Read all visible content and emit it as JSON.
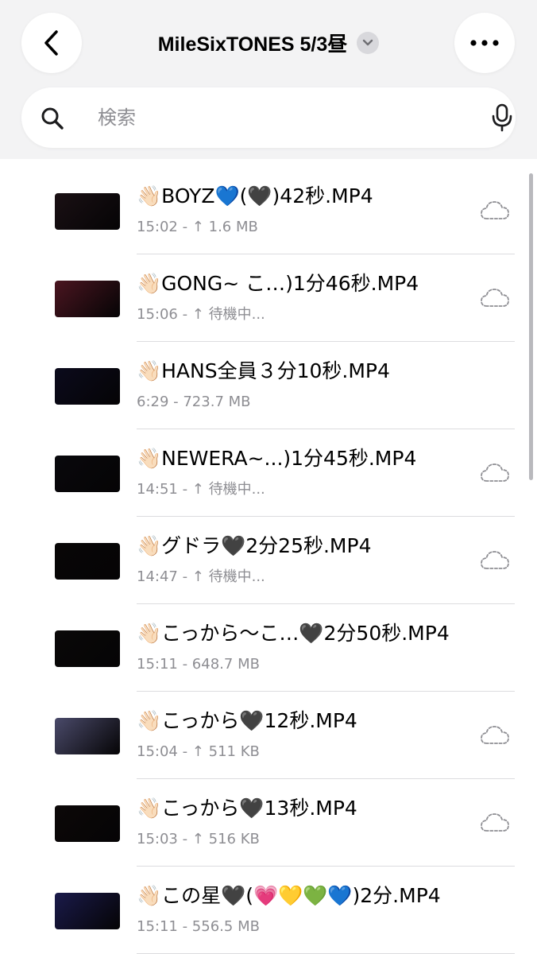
{
  "header": {
    "title": "MileSixTONES 5/3昼",
    "back_icon": "chevron-left-icon",
    "title_menu_icon": "chevron-down-icon",
    "more_icon": "ellipsis-icon"
  },
  "search": {
    "placeholder": "検索",
    "icon": "search-icon",
    "mic_icon": "microphone-icon"
  },
  "files": [
    {
      "name": "👋🏻BOYZ💙(🖤)42秒.MP4",
      "meta": "15:02 - ↑ 1.6 MB",
      "cloud": true,
      "thumb": "#1a1014"
    },
    {
      "name": "👋🏻GONG~ こ…)1分46秒.MP4",
      "meta": "15:06 - ↑ 待機中...",
      "cloud": true,
      "thumb": "#4a1520"
    },
    {
      "name": "👋🏻HANS全員３分10秒.MP4",
      "meta": "6:29 - 723.7 MB",
      "cloud": false,
      "thumb": "#0b0a1c"
    },
    {
      "name": "👋🏻NEWERA~...)1分45秒.MP4",
      "meta": "14:51 - ↑ 待機中...",
      "cloud": true,
      "thumb": "#09080c"
    },
    {
      "name": "👋🏻グドラ🖤2分25秒.MP4",
      "meta": "14:47 - ↑ 待機中...",
      "cloud": true,
      "thumb": "#080606"
    },
    {
      "name": "👋🏻こっから～こ…🖤2分50秒.MP4",
      "meta": "15:11 - 648.7 MB",
      "cloud": false,
      "thumb": "#0a0808"
    },
    {
      "name": "👋🏻こっから🖤12秒.MP4",
      "meta": "15:04 - ↑ 511 KB",
      "cloud": true,
      "thumb": "#4a4a6a"
    },
    {
      "name": "👋🏻こっから🖤13秒.MP4",
      "meta": "15:03 - ↑ 516 KB",
      "cloud": true,
      "thumb": "#0c0808"
    },
    {
      "name": "👋🏻この星🖤(💗💛💚💙)2分.MP4",
      "meta": "15:11 - 556.5 MB",
      "cloud": false,
      "thumb": "#1a1a4a"
    }
  ],
  "colors": {
    "background": "#ffffff",
    "header_background": "#f3f3f4",
    "secondary_text": "#8e8e93",
    "divider": "#dcdcdf"
  }
}
